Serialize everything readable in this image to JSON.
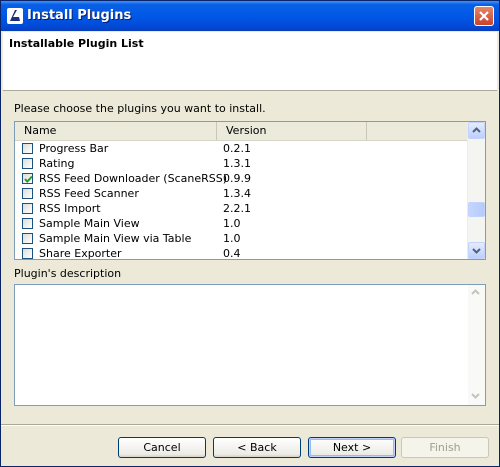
{
  "window": {
    "title": "Install Plugins"
  },
  "header": {
    "title": "Installable Plugin List"
  },
  "instruction": "Please choose the plugins you want to install.",
  "table": {
    "columns": [
      "Name",
      "Version"
    ],
    "rows": [
      {
        "name": "Progress Bar",
        "version": "0.2.1",
        "checked": false
      },
      {
        "name": "Rating",
        "version": "1.3.1",
        "checked": false
      },
      {
        "name": "RSS Feed Downloader (ScaneRSS)",
        "version": "0.9.9",
        "checked": true
      },
      {
        "name": "RSS Feed Scanner",
        "version": "1.3.4",
        "checked": false
      },
      {
        "name": "RSS Import",
        "version": "2.2.1",
        "checked": false
      },
      {
        "name": "Sample Main View",
        "version": "1.0",
        "checked": false
      },
      {
        "name": "Sample Main View via Table",
        "version": "1.0",
        "checked": false
      },
      {
        "name": "Share Exporter",
        "version": "0.4",
        "checked": false
      }
    ]
  },
  "description": {
    "label": "Plugin's description",
    "value": ""
  },
  "buttons": {
    "cancel": "Cancel",
    "back": "< Back",
    "next": "Next >",
    "finish": "Finish"
  },
  "colors": {
    "titlebar": "#0058e6",
    "dialog_bg": "#ece9d8",
    "checkmark": "#21a121"
  }
}
